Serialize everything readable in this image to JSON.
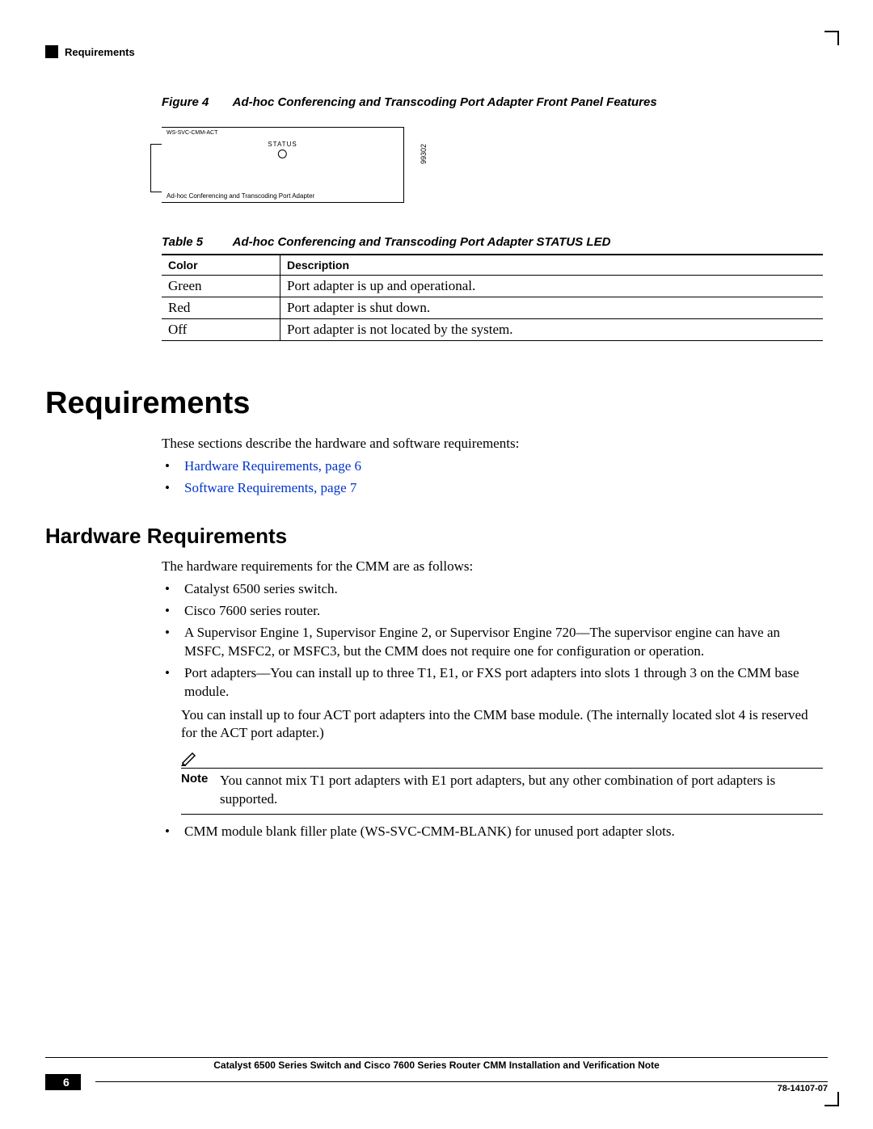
{
  "header": {
    "section": "Requirements"
  },
  "figure": {
    "label": "Figure 4",
    "title": "Ad-hoc Conferencing and Transcoding Port Adapter Front Panel Features",
    "top_label": "WS-SVC-CMM-ACT",
    "status_label": "STATUS",
    "bottom_label": "Ad-hoc Conferencing and Transcoding Port Adapter",
    "side_num": "99302"
  },
  "table": {
    "label": "Table 5",
    "title": "Ad-hoc Conferencing and Transcoding Port Adapter STATUS LED",
    "headers": {
      "col1": "Color",
      "col2": "Description"
    },
    "rows": [
      {
        "color": "Green",
        "desc": "Port adapter is up and operational."
      },
      {
        "color": "Red",
        "desc": "Port adapter is shut down."
      },
      {
        "color": "Off",
        "desc": "Port adapter is not located by the system."
      }
    ]
  },
  "sections": {
    "requirements_h1": "Requirements",
    "requirements_intro": "These sections describe the hardware and software requirements:",
    "links": [
      "Hardware Requirements, page 6",
      "Software Requirements, page 7"
    ],
    "hw_h2": "Hardware Requirements",
    "hw_intro": "The hardware requirements for the CMM are as follows:",
    "hw_bullets": [
      "Catalyst 6500 series switch.",
      "Cisco 7600 series router.",
      "A Supervisor Engine 1, Supervisor Engine 2, or Supervisor Engine 720—The supervisor engine can have an MSFC, MSFC2, or MSFC3, but the CMM does not require one for configuration or operation.",
      "Port adapters—You can install up to three T1, E1, or FXS port adapters into slots 1 through 3 on the CMM base module."
    ],
    "hw_para": "You can install up to four ACT port adapters into the CMM base module. (The internally located slot 4 is reserved for the ACT port adapter.)",
    "note_label": "Note",
    "note_text": "You cannot mix T1 port adapters with E1 port adapters, but any other combination of port adapters is supported.",
    "hw_last_bullet": "CMM module blank filler plate (WS-SVC-CMM-BLANK) for unused port adapter slots."
  },
  "footer": {
    "title": "Catalyst 6500 Series Switch and Cisco 7600 Series Router CMM Installation and Verification Note",
    "page": "6",
    "docnum": "78-14107-07"
  }
}
